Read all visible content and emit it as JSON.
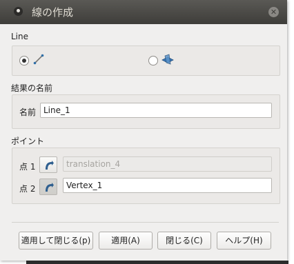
{
  "window": {
    "title": "線の作成"
  },
  "line_section": {
    "label": "Line",
    "options": [
      {
        "icon": "line-two-points-icon",
        "checked": true
      },
      {
        "icon": "line-plane-intersection-icon",
        "checked": false
      }
    ]
  },
  "result_section": {
    "label": "結果の名前",
    "name_label": "名前",
    "name_value": "Line_1"
  },
  "points_section": {
    "label": "ポイント",
    "point1": {
      "label": "点 1",
      "value": "translation_4",
      "disabled": true
    },
    "point2": {
      "label": "点 2",
      "value": "Vertex_1",
      "disabled": false
    }
  },
  "buttons": {
    "apply_close": "適用して閉じる(p)",
    "apply": "適用(A)",
    "close": "閉じる(C)",
    "help": "ヘルプ(H)"
  },
  "colors": {
    "titlebar": "#4a4945",
    "dialog_bg": "#f0efee",
    "icon_blue": "#2f6fa8"
  }
}
